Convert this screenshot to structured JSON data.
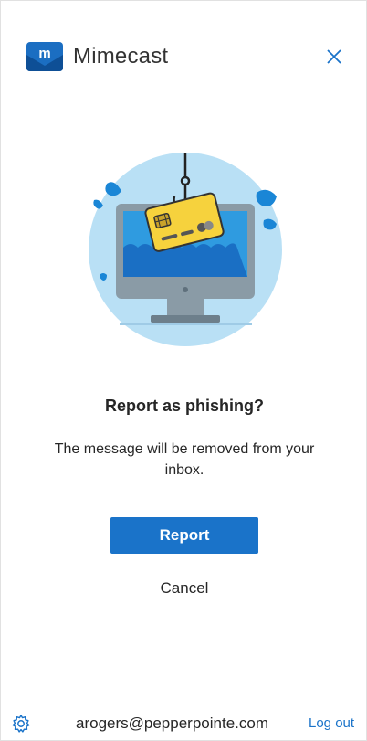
{
  "header": {
    "app_name": "Mimecast",
    "logo_icon": "mimecast-logo-icon",
    "close_icon": "close-icon"
  },
  "illustration": {
    "icon": "phishing-hook-credit-card-illustration"
  },
  "dialog": {
    "title": "Report as phishing?",
    "message": "The message will be removed from your inbox.",
    "report_label": "Report",
    "cancel_label": "Cancel"
  },
  "footer": {
    "settings_icon": "gear-icon",
    "user_email": "arogers@pepperpointe.com",
    "logout_label": "Log out"
  },
  "colors": {
    "accent": "#1a73c9",
    "text": "#262626",
    "illustration_circle": "#b9e0f5"
  }
}
